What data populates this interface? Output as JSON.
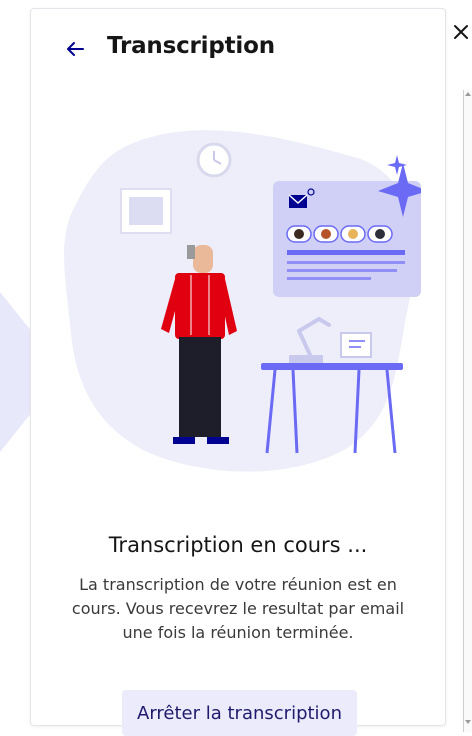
{
  "panel": {
    "title": "Transcription",
    "back_icon": "arrow-left-icon",
    "close_icon": "close-icon"
  },
  "status": {
    "title": "Transcription en cours ...",
    "description": "La transcription de votre réunion est en cours. Vous recevrez le resultat par email une fois la réunion terminée."
  },
  "actions": {
    "stop_label": "Arrêter la transcription"
  },
  "colors": {
    "accent": "#000091",
    "button_bg": "#ecebfb",
    "illustration_blob": "#eeeefb",
    "illustration_purple": "#6a6af4",
    "shirt_red": "#e1000f"
  }
}
